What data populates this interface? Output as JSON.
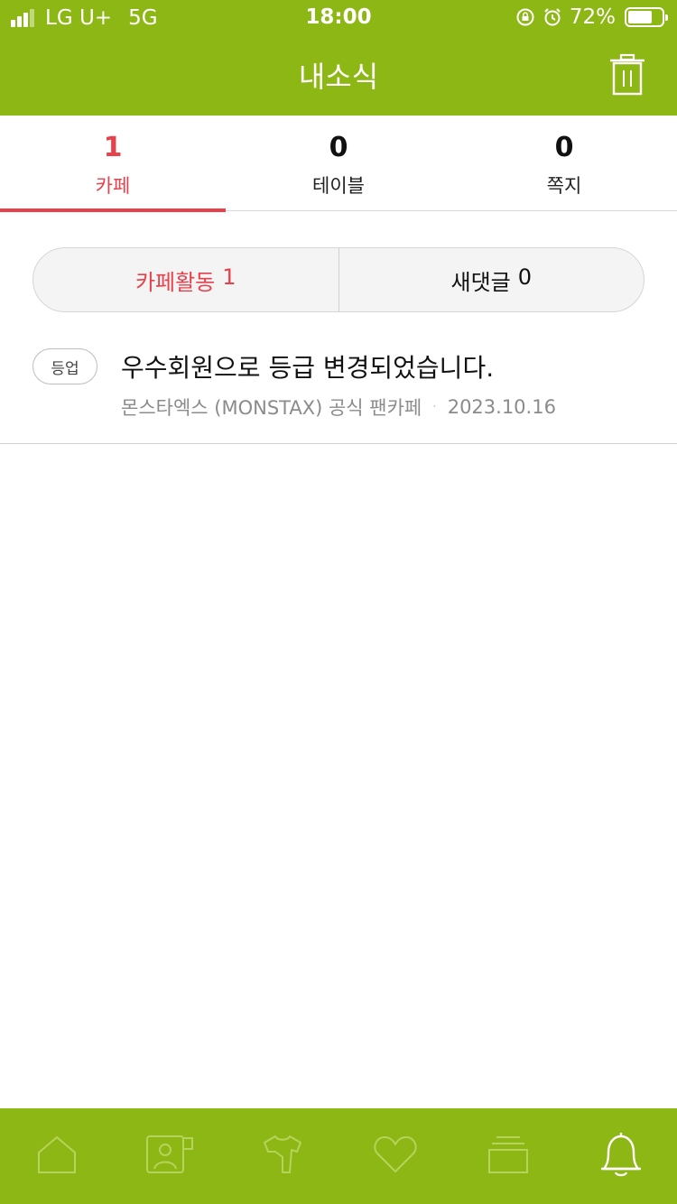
{
  "status_bar": {
    "carrier": "LG U+",
    "network": "5G",
    "time": "18:00",
    "battery_percent": "72%",
    "battery_level": 0.72,
    "icons": [
      "signal-icon",
      "rotation-lock-icon",
      "alarm-icon",
      "battery-icon"
    ]
  },
  "header": {
    "title": "내소식",
    "action_icon": "trash-icon"
  },
  "tabs": [
    {
      "count": "1",
      "label": "카페",
      "active": true
    },
    {
      "count": "0",
      "label": "테이블",
      "active": false
    },
    {
      "count": "0",
      "label": "쪽지",
      "active": false
    }
  ],
  "segments": [
    {
      "label": "카페활동",
      "count": "1",
      "active": true
    },
    {
      "label": "새댓글",
      "count": "0",
      "active": false
    }
  ],
  "notifications": [
    {
      "badge": "등업",
      "title": "우수회원으로 등급 변경되었습니다.",
      "cafe": "몬스타엑스 (MONSTAX) 공식 팬카페",
      "separator": "·",
      "date": "2023.10.16"
    }
  ],
  "bottom_nav": {
    "items": [
      "home-icon",
      "profile-card-icon",
      "shirt-icon",
      "heart-icon",
      "stack-icon",
      "bell-icon"
    ],
    "active": "bell-icon"
  },
  "colors": {
    "brand_green": "#8db714",
    "accent_red": "#e8414b",
    "inactive_icon": "#b6d35a"
  }
}
